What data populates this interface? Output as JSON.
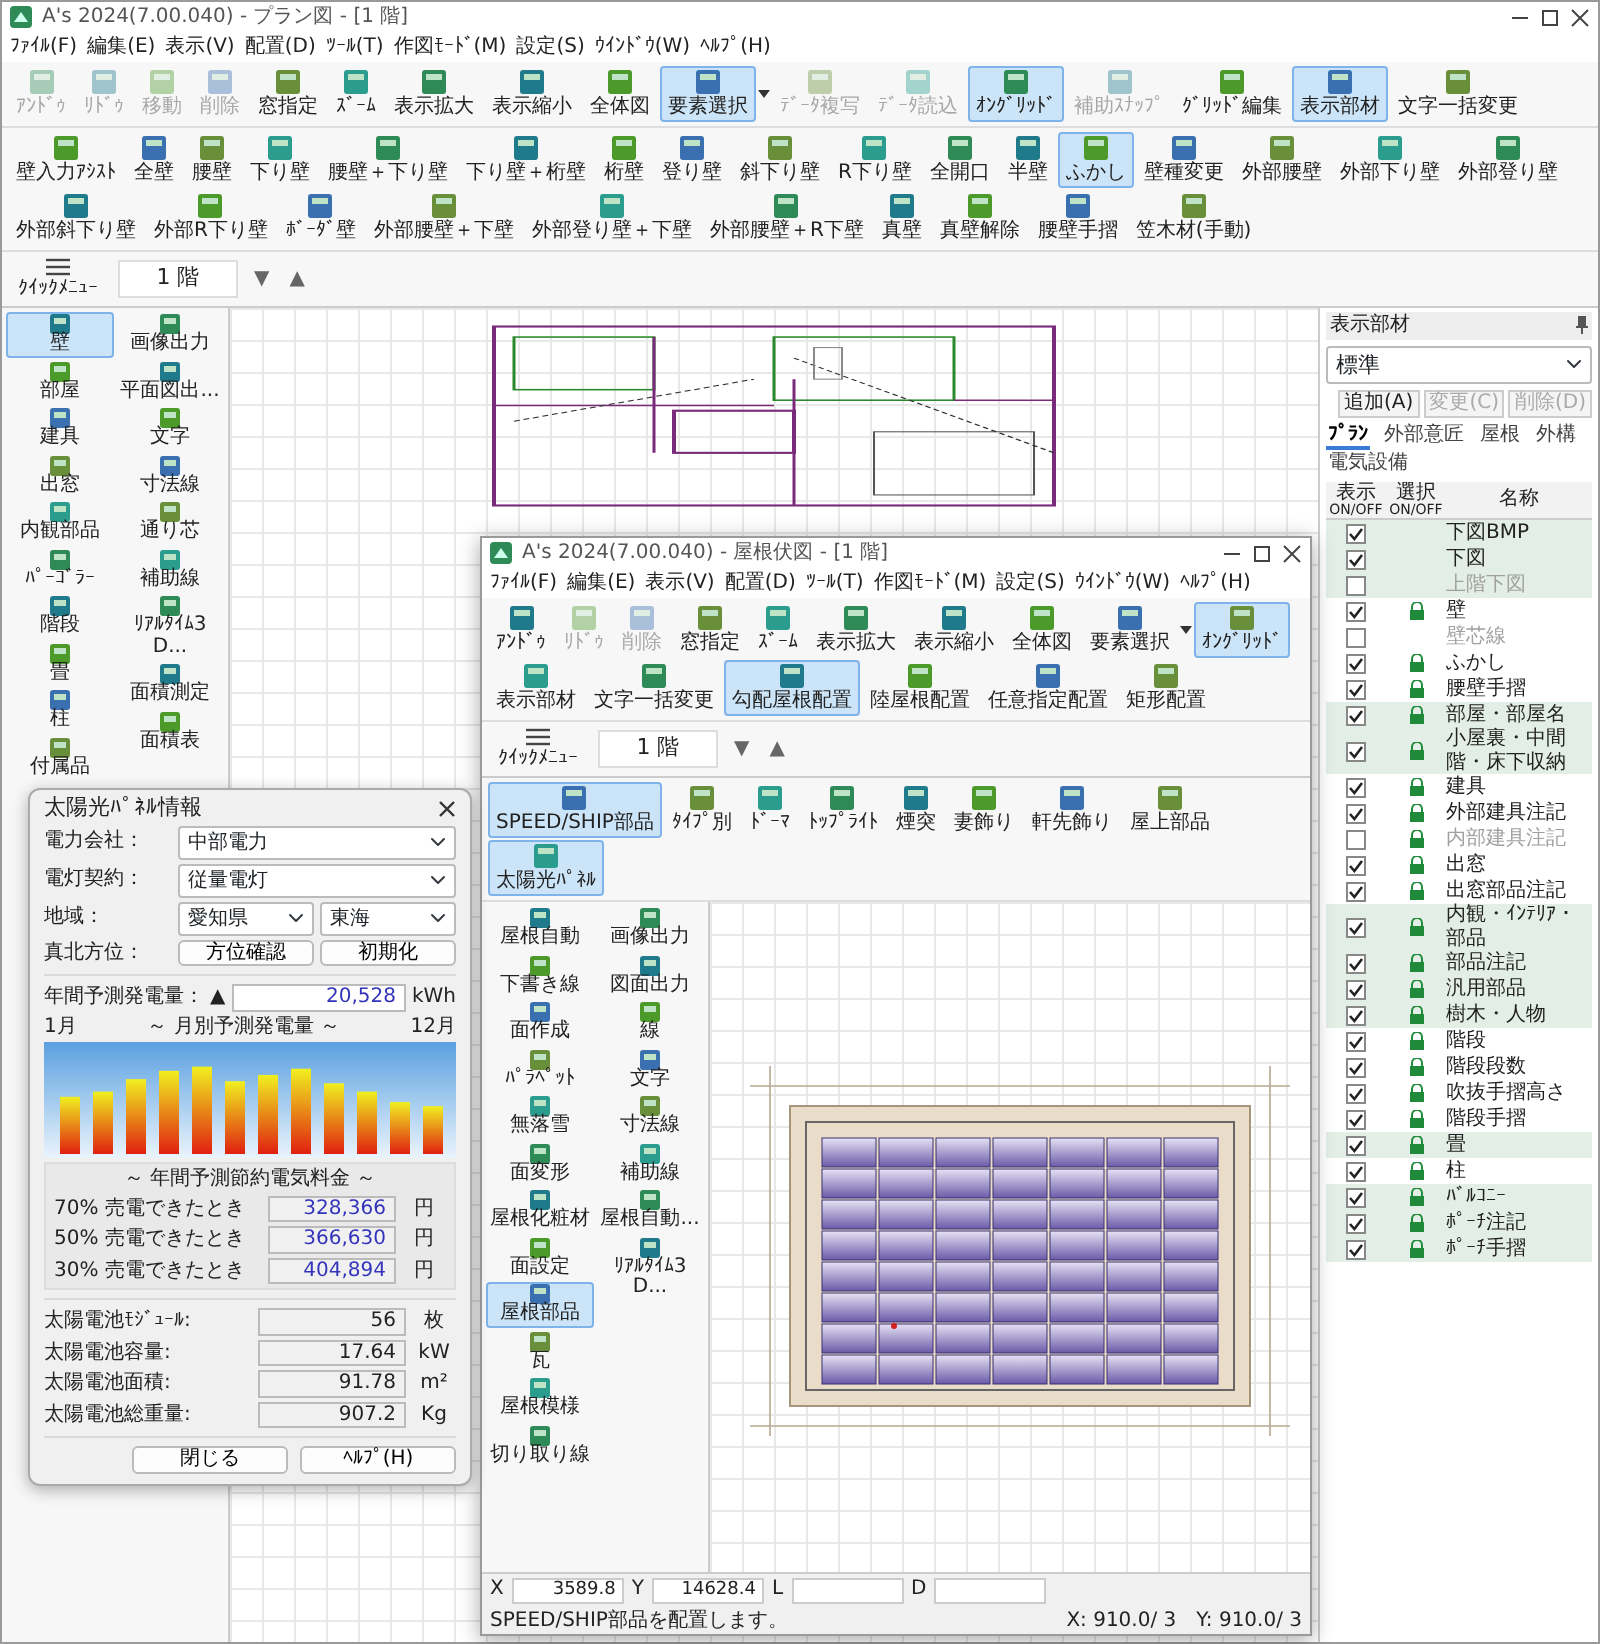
{
  "main_window": {
    "title": "A's 2024(7.00.040) - プラン図 - [1 階]",
    "menu": [
      "ﾌｧｲﾙ(F)",
      "編集(E)",
      "表示(V)",
      "配置(D)",
      "ﾂｰﾙ(T)",
      "作図ﾓｰﾄﾞ(M)",
      "設定(S)",
      "ｳｲﾝﾄﾞｳ(W)",
      "ﾍﾙﾌﾟ(H)"
    ],
    "toolbar": [
      {
        "label": "ｱﾝﾄﾞｩ",
        "selected": false,
        "disabled": true
      },
      {
        "label": "ﾘﾄﾞｩ",
        "selected": false,
        "disabled": true
      },
      {
        "label": "移動",
        "selected": false,
        "disabled": true
      },
      {
        "label": "削除",
        "selected": false,
        "disabled": true
      },
      {
        "label": "窓指定",
        "selected": false,
        "disabled": false
      },
      {
        "label": "ｽﾞｰﾑ",
        "selected": false,
        "disabled": false
      },
      {
        "label": "表示拡大",
        "selected": false,
        "disabled": false
      },
      {
        "label": "表示縮小",
        "selected": false,
        "disabled": false
      },
      {
        "label": "全体図",
        "selected": false,
        "disabled": false
      },
      {
        "label": "要素選択",
        "selected": true,
        "disabled": false,
        "dropdown": true
      },
      {
        "label": "ﾃﾞｰﾀ複写",
        "selected": false,
        "disabled": true
      },
      {
        "label": "ﾃﾞｰﾀ読込",
        "selected": false,
        "disabled": true
      },
      {
        "label": "ｵﾝｸﾞﾘｯﾄﾞ",
        "selected": true,
        "disabled": false
      },
      {
        "label": "補助ｽﾅｯﾌﾟ",
        "selected": false,
        "disabled": true
      },
      {
        "label": "ｸﾞﾘｯﾄﾞ編集",
        "selected": false,
        "disabled": false
      },
      {
        "label": "表示部材",
        "selected": true,
        "disabled": false
      },
      {
        "label": "文字一括変更",
        "selected": false,
        "disabled": false
      }
    ],
    "wall_toolbar": [
      {
        "label": "壁入力ｱｼｽﾄ",
        "selected": false
      },
      {
        "label": "全壁",
        "selected": false
      },
      {
        "label": "腰壁",
        "selected": false
      },
      {
        "label": "下り壁",
        "selected": false
      },
      {
        "label": "腰壁＋下り壁",
        "selected": false
      },
      {
        "label": "下り壁＋桁壁",
        "selected": false
      },
      {
        "label": "桁壁",
        "selected": false
      },
      {
        "label": "登り壁",
        "selected": false
      },
      {
        "label": "斜下り壁",
        "selected": false
      },
      {
        "label": "R下り壁",
        "selected": false
      },
      {
        "label": "全開口",
        "selected": false
      },
      {
        "label": "半壁",
        "selected": false
      },
      {
        "label": "ふかし",
        "selected": true
      },
      {
        "label": "壁種変更",
        "selected": false
      },
      {
        "label": "外部腰壁",
        "selected": false
      },
      {
        "label": "外部下り壁",
        "selected": false
      },
      {
        "label": "外部登り壁",
        "selected": false
      },
      {
        "label": "外部斜下り壁",
        "selected": false
      },
      {
        "label": "外部R下り壁",
        "selected": false
      },
      {
        "label": "ﾎﾞｰﾀﾞ壁",
        "selected": false
      },
      {
        "label": "外部腰壁＋下壁",
        "selected": false
      },
      {
        "label": "外部登り壁＋下壁",
        "selected": false
      },
      {
        "label": "外部腰壁＋R下壁",
        "selected": false
      },
      {
        "label": "真壁",
        "selected": false
      },
      {
        "label": "真壁解除",
        "selected": false
      },
      {
        "label": "腰壁手摺",
        "selected": false
      },
      {
        "label": "笠木材(手動)",
        "selected": false
      }
    ],
    "quick_menu": "ｸｲｯｸﾒﾆｭｰ",
    "floor": "1 階",
    "floor_arrows": [
      "▼",
      "▲"
    ],
    "palette": {
      "columns": [
        {
          "items": [
            {
              "label": "壁",
              "selected": true
            },
            {
              "label": "部屋",
              "selected": false
            },
            {
              "label": "建具",
              "selected": false
            },
            {
              "label": "出窓",
              "selected": false
            },
            {
              "label": "内観部品",
              "selected": false
            },
            {
              "label": "ﾊﾟｰｺﾞﾗｰ",
              "selected": false
            },
            {
              "label": "階段",
              "selected": false
            },
            {
              "label": "畳",
              "selected": false
            },
            {
              "label": "柱",
              "selected": false
            },
            {
              "label": "付属品",
              "selected": false
            }
          ]
        },
        {
          "items": [
            {
              "label": "画像出力",
              "selected": false
            },
            {
              "label": "平面図出...",
              "selected": false
            },
            {
              "label": "文字",
              "selected": false
            },
            {
              "label": "寸法線",
              "selected": false
            },
            {
              "label": "通り芯",
              "selected": false
            },
            {
              "label": "補助線",
              "selected": false
            },
            {
              "label": "ﾘｱﾙﾀｲﾑ3D...",
              "selected": false
            },
            {
              "label": "面積測定",
              "selected": false
            },
            {
              "label": "面積表",
              "selected": false
            }
          ]
        }
      ]
    },
    "display_panel": {
      "title": "表示部材",
      "preset": "標準",
      "buttons": [
        {
          "label": "追加(A)",
          "disabled": false
        },
        {
          "label": "変更(C)",
          "disabled": true
        },
        {
          "label": "削除(D)",
          "disabled": true
        }
      ],
      "tabs": [
        {
          "label": "ﾌﾟﾗﾝ",
          "selected": true
        },
        {
          "label": "外部意匠",
          "selected": false
        },
        {
          "label": "屋根",
          "selected": false
        },
        {
          "label": "外構",
          "selected": false
        },
        {
          "label": "電気設備",
          "selected": false
        }
      ],
      "columns": [
        {
          "lines": [
            "表示",
            "ON/OFF"
          ]
        },
        {
          "lines": [
            "選択",
            "ON/OFF"
          ]
        },
        {
          "lines": [
            "名称"
          ]
        }
      ],
      "rows": [
        {
          "name": "下図BMP",
          "shown": true,
          "lockable": false,
          "shaded": true
        },
        {
          "name": "下図",
          "shown": true,
          "lockable": false,
          "shaded": true
        },
        {
          "name": "上階下図",
          "shown": false,
          "lockable": false,
          "shaded": true
        },
        {
          "name": "壁",
          "shown": true,
          "lockable": true,
          "shaded": false
        },
        {
          "name": "壁芯線",
          "shown": false,
          "lockable": false,
          "shaded": false
        },
        {
          "name": "ふかし",
          "shown": true,
          "lockable": true,
          "shaded": false
        },
        {
          "name": "腰壁手摺",
          "shown": true,
          "lockable": true,
          "shaded": false
        },
        {
          "name": "部屋・部屋名",
          "shown": true,
          "lockable": true,
          "shaded": true
        },
        {
          "name": "小屋裏・中間階・床下収納",
          "shown": true,
          "lockable": true,
          "shaded": true
        },
        {
          "name": "建具",
          "shown": true,
          "lockable": true,
          "shaded": false
        },
        {
          "name": "外部建具注記",
          "shown": true,
          "lockable": true,
          "shaded": false
        },
        {
          "name": "内部建具注記",
          "shown": false,
          "lockable": true,
          "shaded": false
        },
        {
          "name": "出窓",
          "shown": true,
          "lockable": true,
          "shaded": false
        },
        {
          "name": "出窓部品注記",
          "shown": true,
          "lockable": true,
          "shaded": false
        },
        {
          "name": "内観・ｲﾝﾃﾘｱ・部品",
          "shown": true,
          "lockable": true,
          "shaded": true
        },
        {
          "name": "部品注記",
          "shown": true,
          "lockable": true,
          "shaded": true
        },
        {
          "name": "汎用部品",
          "shown": true,
          "lockable": true,
          "shaded": true
        },
        {
          "name": "樹木・人物",
          "shown": true,
          "lockable": true,
          "shaded": true
        },
        {
          "name": "階段",
          "shown": true,
          "lockable": true,
          "shaded": false
        },
        {
          "name": "階段段数",
          "shown": true,
          "lockable": true,
          "shaded": false
        },
        {
          "name": "吹抜手摺高さ",
          "shown": true,
          "lockable": true,
          "shaded": false
        },
        {
          "name": "階段手摺",
          "shown": true,
          "lockable": true,
          "shaded": false
        },
        {
          "name": "畳",
          "shown": true,
          "lockable": true,
          "shaded": true
        },
        {
          "name": "柱",
          "shown": true,
          "lockable": true,
          "shaded": false
        },
        {
          "name": "ﾊﾞﾙｺﾆｰ",
          "shown": true,
          "lockable": true,
          "shaded": true
        },
        {
          "name": "ﾎﾟｰﾁ注記",
          "shown": true,
          "lockable": true,
          "shaded": true
        },
        {
          "name": "ﾎﾟｰﾁ手摺",
          "shown": true,
          "lockable": true,
          "shaded": true
        }
      ]
    }
  },
  "dialog": {
    "title": "太陽光ﾊﾟﾈﾙ情報",
    "fields": [
      {
        "label": "電力会社：",
        "values": [
          "中部電力"
        ]
      },
      {
        "label": "電灯契約：",
        "values": [
          "従量電灯"
        ]
      },
      {
        "label": "地域：",
        "values": [
          "愛知県",
          "東海"
        ]
      }
    ],
    "north": {
      "label": "真北方位：",
      "buttons": [
        "方位確認",
        "初期化"
      ]
    },
    "annual": {
      "label": "年間予測発電量：",
      "mark": "▲",
      "value": "20,528",
      "unit": "kWh"
    },
    "chart": {
      "start": "1月",
      "title": "～ 月別予測発電量 ～",
      "end": "12月"
    },
    "savings": {
      "title": "～ 年間予測節約電気料金 ～",
      "rows": [
        {
          "label": "70% 売電できたとき",
          "value": "328,366",
          "unit": "円"
        },
        {
          "label": "50% 売電できたとき",
          "value": "366,630",
          "unit": "円"
        },
        {
          "label": "30% 売電できたとき",
          "value": "404,894",
          "unit": "円"
        }
      ]
    },
    "specs": [
      {
        "label": "太陽電池ﾓｼﾞｭｰﾙ:",
        "value": "56",
        "unit": "枚"
      },
      {
        "label": "太陽電池容量:",
        "value": "17.64",
        "unit": "kW"
      },
      {
        "label": "太陽電池面積:",
        "value": "91.78",
        "unit": "m²"
      },
      {
        "label": "太陽電池総重量:",
        "value": "907.2",
        "unit": "Kg"
      }
    ],
    "buttons": [
      "閉じる",
      "ﾍﾙﾌﾟ(H)"
    ]
  },
  "roof_window": {
    "title": "A's 2024(7.00.040) - 屋根伏図 - [1 階]",
    "menu": [
      "ﾌｧｲﾙ(F)",
      "編集(E)",
      "表示(V)",
      "配置(D)",
      "ﾂｰﾙ(T)",
      "作図ﾓｰﾄﾞ(M)",
      "設定(S)",
      "ｳｲﾝﾄﾞｳ(W)",
      "ﾍﾙﾌﾟ(H)"
    ],
    "toolbar": [
      {
        "label": "ｱﾝﾄﾞｩ",
        "selected": false,
        "disabled": false
      },
      {
        "label": "ﾘﾄﾞｩ",
        "selected": false,
        "disabled": true
      },
      {
        "label": "削除",
        "selected": false,
        "disabled": true
      },
      {
        "label": "窓指定",
        "selected": false,
        "disabled": false
      },
      {
        "label": "ｽﾞｰﾑ",
        "selected": false,
        "disabled": false
      },
      {
        "label": "表示拡大",
        "selected": false,
        "disabled": false
      },
      {
        "label": "表示縮小",
        "selected": false,
        "disabled": false
      },
      {
        "label": "全体図",
        "selected": false,
        "disabled": false
      },
      {
        "label": "要素選択",
        "selected": false,
        "disabled": false,
        "dropdown": true
      },
      {
        "label": "ｵﾝｸﾞﾘｯﾄﾞ",
        "selected": true,
        "disabled": false
      },
      {
        "label": "表示部材",
        "selected": false,
        "disabled": false
      },
      {
        "label": "文字一括変更",
        "selected": false,
        "disabled": false
      },
      {
        "label": "勾配屋根配置",
        "selected": true,
        "disabled": false
      },
      {
        "label": "陸屋根配置",
        "selected": false,
        "disabled": false
      },
      {
        "label": "任意指定配置",
        "selected": false,
        "disabled": false
      },
      {
        "label": "矩形配置",
        "selected": false,
        "disabled": false
      }
    ],
    "quick_menu": "ｸｲｯｸﾒﾆｭｰ",
    "floor": "1 階",
    "floor_arrows": [
      "▼",
      "▲"
    ],
    "roof_toolbar": [
      {
        "label": "SPEED/SHIP部品",
        "selected": true
      },
      {
        "label": "ﾀｲﾌﾟ別",
        "selected": false
      },
      {
        "label": "ﾄﾞｰﾏ",
        "selected": false
      },
      {
        "label": "ﾄｯﾌﾟﾗｲﾄ",
        "selected": false
      },
      {
        "label": "煙突",
        "selected": false
      },
      {
        "label": "妻飾り",
        "selected": false
      },
      {
        "label": "軒先飾り",
        "selected": false
      },
      {
        "label": "屋上部品",
        "selected": false
      },
      {
        "label": "太陽光ﾊﾟﾈﾙ",
        "selected": true
      }
    ],
    "palette": {
      "columns": [
        {
          "items": [
            {
              "label": "屋根自動",
              "selected": false
            },
            {
              "label": "下書き線",
              "selected": false
            },
            {
              "label": "面作成",
              "selected": false
            },
            {
              "label": "ﾊﾟﾗﾍﾟｯﾄ",
              "selected": false
            },
            {
              "label": "無落雪",
              "selected": false
            },
            {
              "label": "面変形",
              "selected": false
            },
            {
              "label": "屋根化粧材",
              "selected": false
            },
            {
              "label": "面設定",
              "selected": false
            },
            {
              "label": "屋根部品",
              "selected": true
            },
            {
              "label": "瓦",
              "selected": false
            },
            {
              "label": "屋根模様",
              "selected": false
            },
            {
              "label": "切り取り線",
              "selected": false
            }
          ]
        },
        {
          "items": [
            {
              "label": "画像出力",
              "selected": false
            },
            {
              "label": "図面出力",
              "selected": false
            },
            {
              "label": "線",
              "selected": false
            },
            {
              "label": "文字",
              "selected": false
            },
            {
              "label": "寸法線",
              "selected": false
            },
            {
              "label": "補助線",
              "selected": false
            },
            {
              "label": "屋根自動...",
              "selected": false
            },
            {
              "label": "ﾘｱﾙﾀｲﾑ3D...",
              "selected": false
            }
          ]
        }
      ]
    },
    "coords": [
      {
        "label": "X",
        "value": "3589.8"
      },
      {
        "label": "Y",
        "value": "14628.4"
      },
      {
        "label": "L"
      },
      {
        "label": "D"
      }
    ],
    "status": "SPEED/SHIP部品を配置します。",
    "cursor": [
      "X: 910.0/ 3",
      "Y: 910.0/ 3"
    ]
  }
}
